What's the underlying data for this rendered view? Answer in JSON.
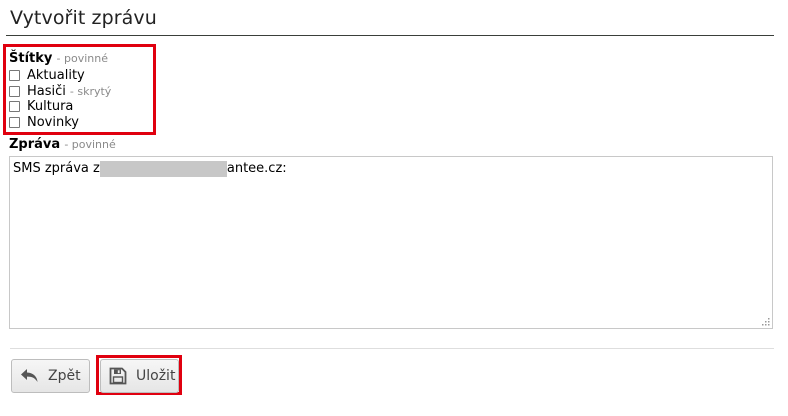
{
  "page": {
    "title": "Vytvořit zprávu"
  },
  "tags": {
    "label": "Štítky",
    "required_note": "- povinné",
    "items": [
      {
        "label": "Aktuality",
        "note": ""
      },
      {
        "label": "Hasiči",
        "note": "- skrytý"
      },
      {
        "label": "Kultura",
        "note": ""
      },
      {
        "label": "Novinky",
        "note": ""
      }
    ]
  },
  "message": {
    "label": "Zpráva",
    "required_note": "- povinné",
    "text_prefix": "SMS zpráva z",
    "text_suffix": "antee.cz:"
  },
  "actions": {
    "back_label": "Zpět",
    "save_label": "Uložit"
  },
  "colors": {
    "highlight": "#e0000f",
    "redaction": "#c7c7c7"
  },
  "icons": {
    "back": "undo-arrow-icon",
    "save": "floppy-disk-icon"
  }
}
